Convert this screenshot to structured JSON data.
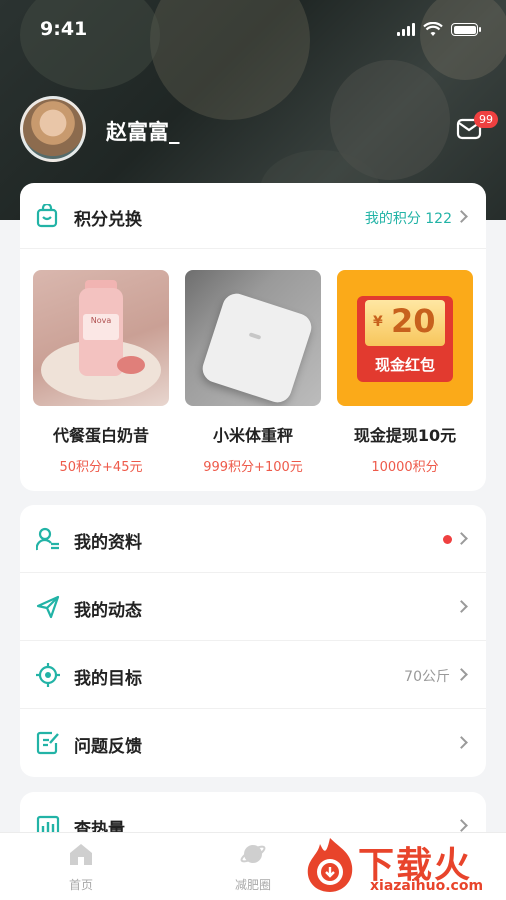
{
  "status_bar": {
    "time": "9:41"
  },
  "profile": {
    "username": "赵富富_",
    "mail_badge": "99"
  },
  "points_card": {
    "title": "积分兑换",
    "my_points": "我的积分 122",
    "products": [
      {
        "name": "代餐蛋白奶昔",
        "price": "50积分+45元",
        "image_text": "Nova"
      },
      {
        "name": "小米体重秤",
        "price": "999积分+100元"
      },
      {
        "name": "现金提现10元",
        "price": "10000积分",
        "bill_yen": "¥",
        "bill_amount": "20",
        "bill_label": "现金红包"
      }
    ]
  },
  "menu": [
    {
      "label": "我的资料",
      "has_dot": true,
      "value": ""
    },
    {
      "label": "我的动态",
      "has_dot": false,
      "value": ""
    },
    {
      "label": "我的目标",
      "has_dot": false,
      "value": "70公斤"
    },
    {
      "label": "问题反馈",
      "has_dot": false,
      "value": ""
    }
  ],
  "menu2": [
    {
      "label": "查热量"
    }
  ],
  "tabbar": [
    {
      "label": "首页"
    },
    {
      "label": "减肥圈"
    }
  ],
  "watermark": {
    "cn": "下载火",
    "en": "xiazaihuo.com"
  },
  "colors": {
    "accent": "#22b3a6",
    "red": "#ef4040",
    "price": "#ee5a4a"
  },
  "icons": {
    "points": "shopping-bag-icon",
    "menu": [
      "user-profile-icon",
      "send-icon",
      "target-icon",
      "feedback-icon"
    ],
    "calories": "bar-chart-icon",
    "tabs": [
      "home-icon",
      "planet-icon"
    ]
  }
}
